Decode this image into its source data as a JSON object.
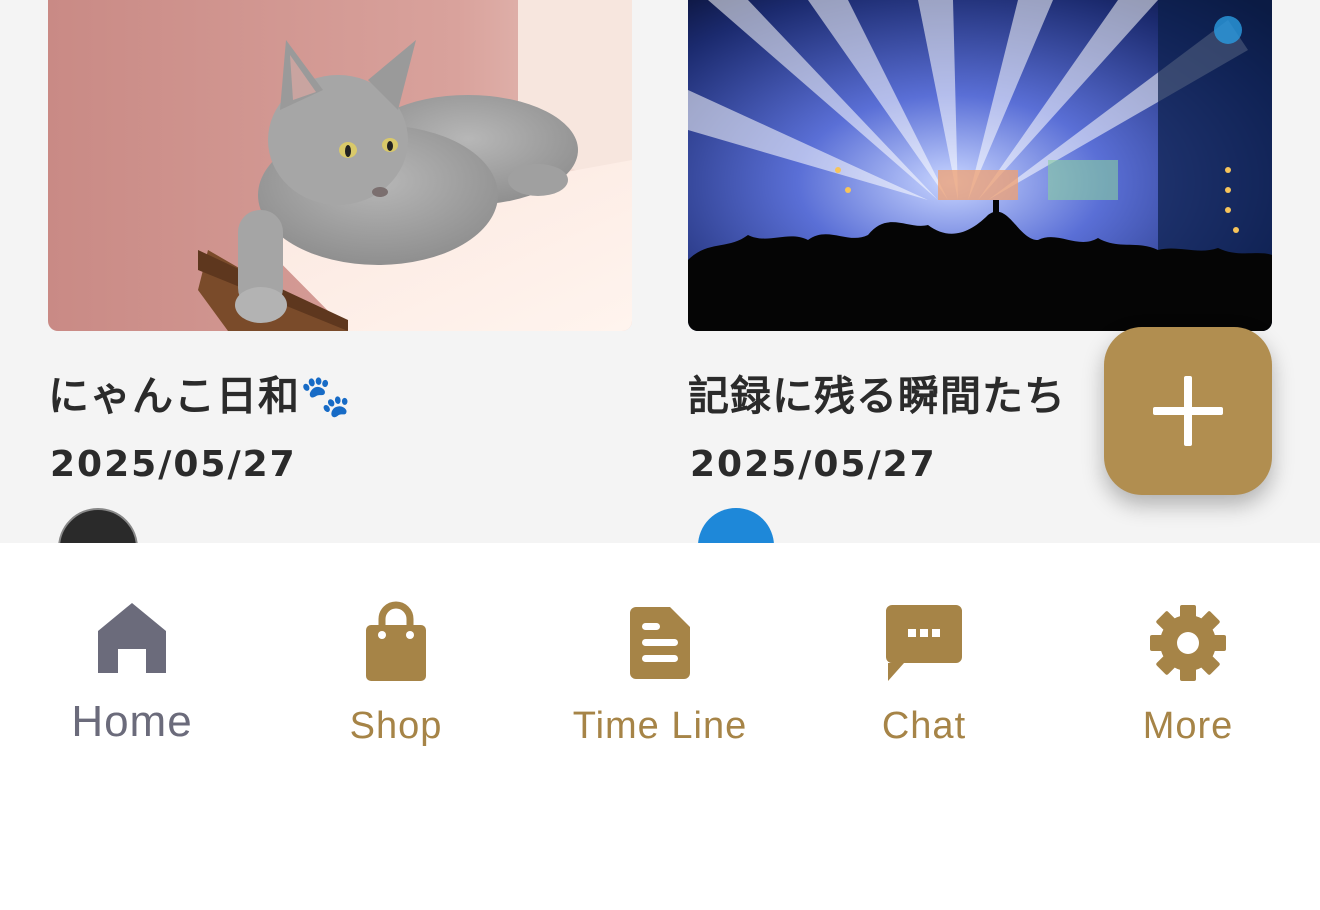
{
  "cards": [
    {
      "title": "にゃんこ日和🐾",
      "date": "2025/05/27",
      "image": "gray-cat-photo"
    },
    {
      "title": "記録に残る瞬間たち",
      "date": "2025/05/27",
      "image": "concert-stage-lights-photo"
    }
  ],
  "fab": {
    "icon": "plus-icon"
  },
  "tabs": [
    {
      "label": "Home",
      "icon": "home-icon",
      "active": true
    },
    {
      "label": "Shop",
      "icon": "shopping-bag-icon",
      "active": false
    },
    {
      "label": "Time Line",
      "icon": "document-icon",
      "active": false
    },
    {
      "label": "Chat",
      "icon": "chat-bubble-icon",
      "active": false
    },
    {
      "label": "More",
      "icon": "gear-icon",
      "active": false
    }
  ],
  "colors": {
    "accent": "#b18e50",
    "tab_inactive": "#a68447",
    "tab_active": "#6b6b7b",
    "content_bg": "#f4f4f4",
    "text": "#2b2b2b"
  }
}
